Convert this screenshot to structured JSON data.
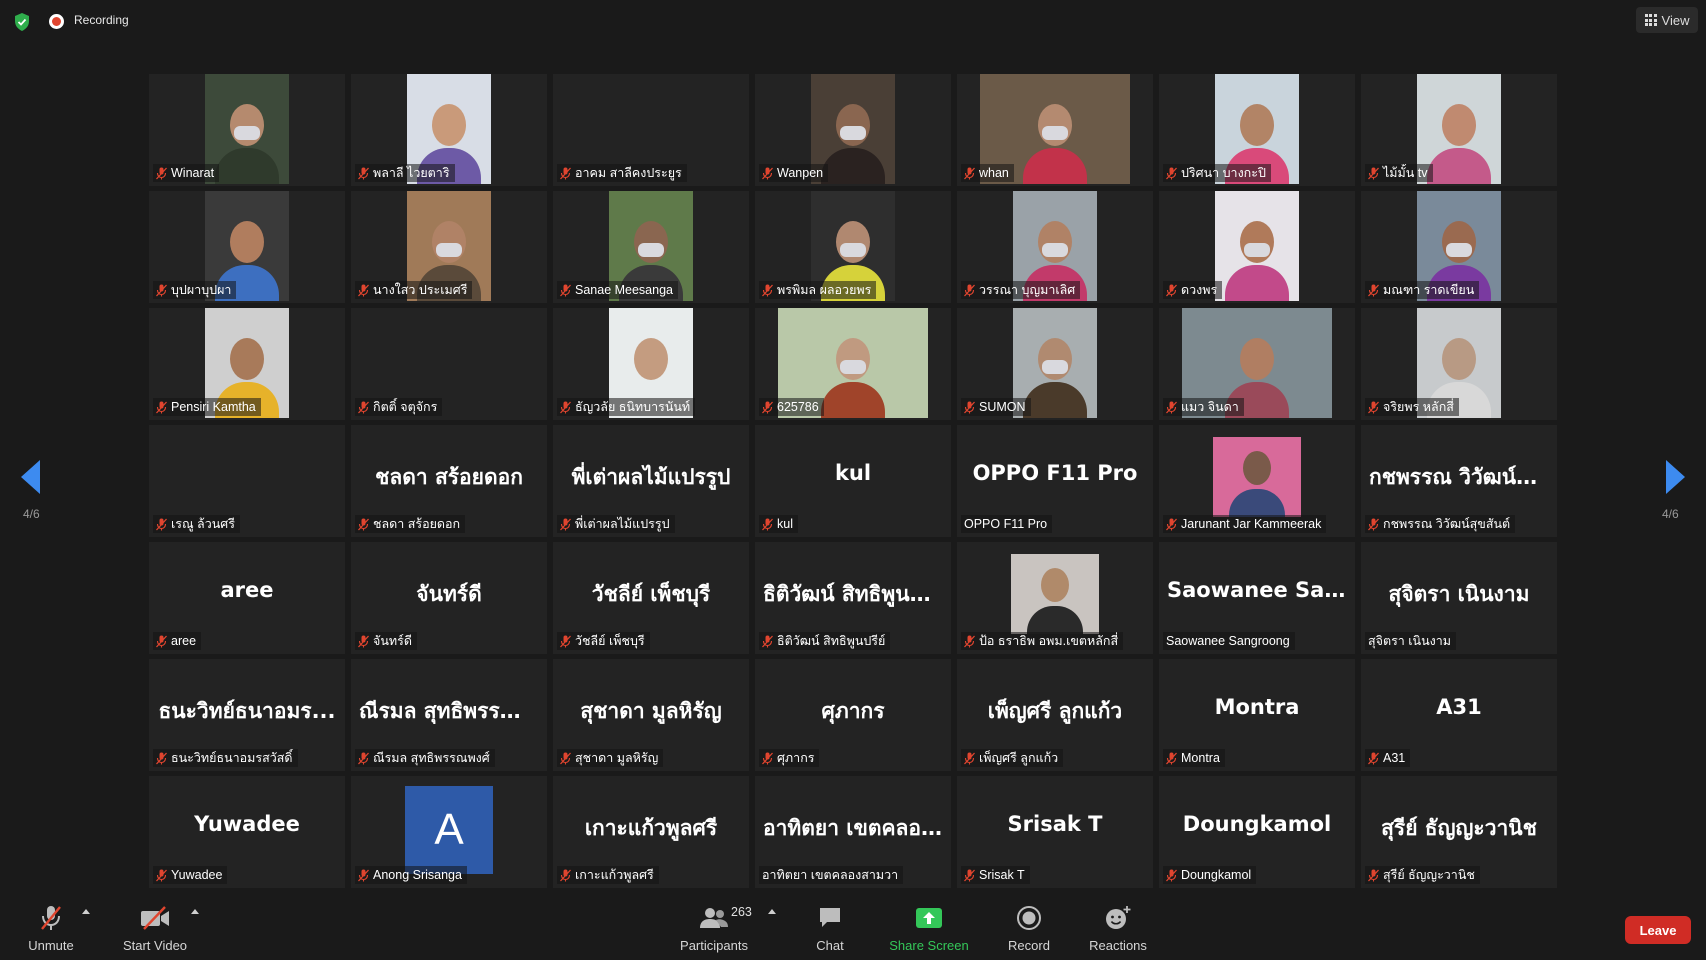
{
  "topbar": {
    "recording_label": "Recording",
    "view_label": "View"
  },
  "pagination": {
    "left_label": "4/6",
    "right_label": "4/6"
  },
  "tiles": [
    {
      "label": "Winarat",
      "video": true,
      "bg": "#3d4a3a",
      "skin": "#b58a6e",
      "shirt": "#2f3a2c",
      "mask": true
    },
    {
      "label": "พลาลี ไวยตาริ",
      "video": true,
      "bg": "#d8dde6",
      "skin": "#c99a7a",
      "shirt": "#6d5aa6",
      "mask": false
    },
    {
      "label": "อาคม สาลีคงประยูร",
      "video": false,
      "big": ""
    },
    {
      "label": "Wanpen",
      "video": true,
      "bg": "#4a3f36",
      "skin": "#8a6650",
      "shirt": "#2a2220",
      "mask": true
    },
    {
      "label": "whan",
      "video": true,
      "bg": "#6b5a48",
      "skin": "#b48a70",
      "shirt": "#c2324a",
      "mask": true,
      "wide": true
    },
    {
      "label": "ปริศนา บางกะปิ",
      "video": true,
      "bg": "#c9d4dc",
      "skin": "#b28466",
      "shirt": "#d94a7a",
      "mask": false
    },
    {
      "label": "ไม้มั้น tv",
      "video": true,
      "bg": "#cfd6d8",
      "skin": "#c08a70",
      "shirt": "#c45a8a",
      "mask": false
    },
    {
      "label": "บุปผาบุปผา",
      "video": true,
      "bg": "#3a3a3a",
      "skin": "#b07d5e",
      "shirt": "#3d6fc0",
      "mask": false
    },
    {
      "label": "นางใสว ประเมศรี",
      "video": true,
      "bg": "#a07a58",
      "skin": "#b08266",
      "shirt": "#5a4a3a",
      "mask": true
    },
    {
      "label": "Sanae Meesanga",
      "video": true,
      "bg": "#5f7a4a",
      "skin": "#8a6650",
      "shirt": "#3a3a3a",
      "mask": true
    },
    {
      "label": "พรพิมล ผลอวยพร",
      "video": true,
      "bg": "#2e2e2e",
      "skin": "#b08870",
      "shirt": "#d6d23a",
      "mask": true
    },
    {
      "label": "วรรณา บุญมาเลิศ",
      "video": true,
      "bg": "#9aa2a8",
      "skin": "#b08266",
      "shirt": "#c23a6a",
      "mask": true
    },
    {
      "label": "ดวงพร",
      "video": true,
      "bg": "#e6e3e8",
      "skin": "#b07a5a",
      "shirt": "#c24a8a",
      "mask": true
    },
    {
      "label": "มณฑา ราดเขียน",
      "video": true,
      "bg": "#7a8a9a",
      "skin": "#9a6a50",
      "shirt": "#7a3aa0",
      "mask": true
    },
    {
      "label": "Pensiri Kamtha",
      "video": true,
      "bg": "#cfcfcf",
      "skin": "#a87a5a",
      "shirt": "#e6b22a",
      "mask": false
    },
    {
      "label": "กิตติ์ จตุจักร",
      "video": false,
      "big": ""
    },
    {
      "label": "ธัญวลัย ธนิทบารนันท์",
      "video": true,
      "bg": "#e8ecec",
      "skin": "#c49c80",
      "shirt": "#e8ecec",
      "mask": false
    },
    {
      "label": "625786",
      "video": true,
      "bg": "#b9c8a8",
      "skin": "#c09a80",
      "shirt": "#a0442a",
      "mask": true,
      "wide": true
    },
    {
      "label": "SUMON",
      "video": true,
      "bg": "#a8aeb0",
      "skin": "#b08a70",
      "shirt": "#4a3a2a",
      "mask": true
    },
    {
      "label": "แมว จินดา",
      "video": true,
      "bg": "#7d8a90",
      "skin": "#b07e62",
      "shirt": "#9a4a5a",
      "mask": false,
      "wide": true
    },
    {
      "label": "จริยพร หลักสี่",
      "video": true,
      "bg": "#c7cacc",
      "skin": "#b89a84",
      "shirt": "#d8d8d8",
      "mask": false
    },
    {
      "label": "เรณู ล้วนศรี",
      "video": false,
      "big": ""
    },
    {
      "label": "ชลดา สร้อยดอก",
      "video": false,
      "big": "ชลดา  สร้อยดอก"
    },
    {
      "label": "พี่เต่าผลไม้แปรรูป",
      "video": false,
      "big": "พี่เต่าผลไม้แปรรูป"
    },
    {
      "label": "kul",
      "video": false,
      "big": "kul"
    },
    {
      "label": "OPPO F11 Pro",
      "video": false,
      "big": "OPPO F11 Pro",
      "nomic": true
    },
    {
      "label": "Jarunant Jar Kammeerak",
      "video": false,
      "picture": true,
      "pbg": "#d86a9a",
      "pskin": "#7a5a4a",
      "pshirt": "#3a4a7a"
    },
    {
      "label": "กชพรรณ วิวัฒน์สุขสันต์",
      "video": false,
      "big": "กชพรรณ วิวัฒน์สุ..."
    },
    {
      "label": "aree",
      "video": false,
      "big": "aree"
    },
    {
      "label": "จันทร์ดี",
      "video": false,
      "big": "จันทร์ดี"
    },
    {
      "label": "วัชลีย์ เพ็ชบุรี",
      "video": false,
      "big": "วัชลีย์ เพ็ชบุรี"
    },
    {
      "label": "ธิติวัฒน์ สิทธิพูนปรีย์",
      "video": false,
      "big": "ธิติวัฒน์ สิทธิพูนป..."
    },
    {
      "label": "ป้อ ธราธิพ อพม.เขตหลักสี่",
      "video": false,
      "picture": true,
      "pbg": "#c9c4c0",
      "pskin": "#b08a6a",
      "pshirt": "#2a2a2a"
    },
    {
      "label": "Saowanee Sangroong",
      "video": false,
      "big": "Saowanee Sang...",
      "nomic": true
    },
    {
      "label": "สุจิตรา เนินงาม",
      "video": false,
      "big": "สุจิตรา  เนินงาม",
      "nomic": true
    },
    {
      "label": "ธนะวิทย์ธนาอมรสวัสดิ์",
      "video": false,
      "big": "ธนะวิทย์ธนาอมร..."
    },
    {
      "label": "ณีรมล สุทธิพรรณพงศ์",
      "video": false,
      "big": "ณีรมล สุทธิพรรณ..."
    },
    {
      "label": "สุชาดา มูลหิรัญ",
      "video": false,
      "big": "สุชาดา  มูลหิรัญ"
    },
    {
      "label": "ศุภากร",
      "video": false,
      "big": "ศุภากร"
    },
    {
      "label": "เพ็ญศรี ลูกแก้ว",
      "video": false,
      "big": "เพ็ญศรี  ลูกแก้ว"
    },
    {
      "label": "Montra",
      "video": false,
      "big": "Montra"
    },
    {
      "label": "A31",
      "video": false,
      "big": "A31"
    },
    {
      "label": "Yuwadee",
      "video": false,
      "big": "Yuwadee"
    },
    {
      "label": "Anong Srisanga",
      "video": false,
      "letter": "A"
    },
    {
      "label": "เกาะแก้วพูลศรี",
      "video": false,
      "big": "เกาะแก้วพูลศรี"
    },
    {
      "label": "อาทิตยา เขตคลองสามวา",
      "video": false,
      "big": "อาทิตยา เขตคลอง...",
      "nomic": true
    },
    {
      "label": "Srisak T",
      "video": false,
      "big": "Srisak T"
    },
    {
      "label": "Doungkamol",
      "video": false,
      "big": "Doungkamol"
    },
    {
      "label": "สุรีย์ ธัญญะวานิช",
      "video": false,
      "big": "สุรีย์  ธัญญะวานิช"
    }
  ],
  "toolbar": {
    "unmute_label": "Unmute",
    "start_video_label": "Start Video",
    "participants_label": "Participants",
    "participants_count": "263",
    "chat_label": "Chat",
    "share_label": "Share Screen",
    "record_label": "Record",
    "reactions_label": "Reactions",
    "leave_label": "Leave"
  },
  "colors": {
    "accent": "#3d8bf0",
    "share_green": "#34c759",
    "leave_red": "#d02c25",
    "recording_red": "#e0452f"
  }
}
